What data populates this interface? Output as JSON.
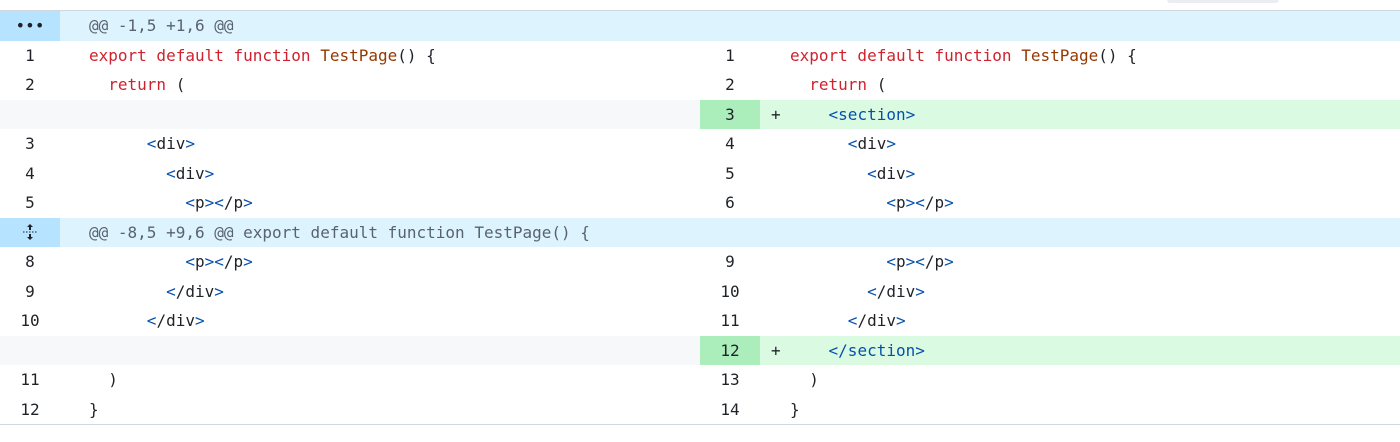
{
  "hunks": {
    "first": {
      "header": "@@ -1,5 +1,6 @@",
      "icon": "ellipsis-icon",
      "icon_glyph": "•••"
    },
    "second": {
      "header": "@@ -8,5 +9,6 @@ export default function TestPage() {",
      "icon": "expand-icon"
    }
  },
  "tokens": {
    "export_default_function": "export default function ",
    "test_page": "TestPage",
    "fn_open": "() {",
    "return": "return",
    "paren_open": " (",
    "section_open": "section",
    "section_close": "/section",
    "div": "div",
    "div_close": "/div",
    "p": "p",
    "p_close": "/p",
    "lt": "<",
    "gt": ">",
    "paren_close": ")",
    "brace_close": "}",
    "plus": "+"
  },
  "line_numbers": {
    "left": [
      "1",
      "2",
      "3",
      "4",
      "5",
      "8",
      "9",
      "10",
      "11",
      "12"
    ],
    "right": [
      "1",
      "2",
      "3",
      "4",
      "5",
      "6",
      "9",
      "10",
      "11",
      "12",
      "13",
      "14"
    ]
  },
  "colors": {
    "hunk_bg": "#ddf4ff",
    "hunk_gutter": "#b6e3ff",
    "added_bg": "#dafbe1",
    "added_num_bg": "#aceebb",
    "keyword": "#cf222e",
    "function_name": "#953800",
    "tag": "#0550ae"
  }
}
